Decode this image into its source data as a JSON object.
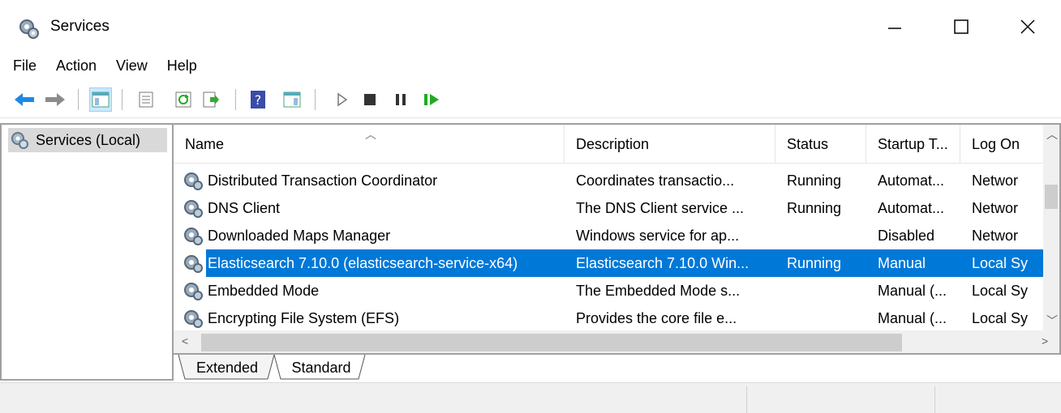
{
  "window": {
    "title": "Services"
  },
  "menu": [
    "File",
    "Action",
    "View",
    "Help"
  ],
  "left": {
    "tree_label": "Services (Local)"
  },
  "columns": [
    "Name",
    "Description",
    "Status",
    "Startup T...",
    "Log On"
  ],
  "rows": [
    {
      "name": "Distributed Transaction Coordinator",
      "description": "Coordinates transactio...",
      "status": "Running",
      "startup": "Automat...",
      "logon": "Networ"
    },
    {
      "name": "DNS Client",
      "description": "The DNS Client service ...",
      "status": "Running",
      "startup": "Automat...",
      "logon": "Networ"
    },
    {
      "name": "Downloaded Maps Manager",
      "description": "Windows service for ap...",
      "status": "",
      "startup": "Disabled",
      "logon": "Networ"
    },
    {
      "name": "Elasticsearch 7.10.0 (elasticsearch-service-x64)",
      "description": "Elasticsearch 7.10.0 Win...",
      "status": "Running",
      "startup": "Manual",
      "logon": "Local Sy",
      "selected": true
    },
    {
      "name": "Embedded Mode",
      "description": "The Embedded Mode s...",
      "status": "",
      "startup": "Manual (...",
      "logon": "Local Sy"
    },
    {
      "name": "Encrypting File System (EFS)",
      "description": "Provides the core file e...",
      "status": "",
      "startup": "Manual (...",
      "logon": "Local Sy"
    }
  ],
  "tabs": [
    "Extended",
    "Standard"
  ],
  "colors": {
    "selection": "#0078d7",
    "border": "#a0a0a0"
  }
}
